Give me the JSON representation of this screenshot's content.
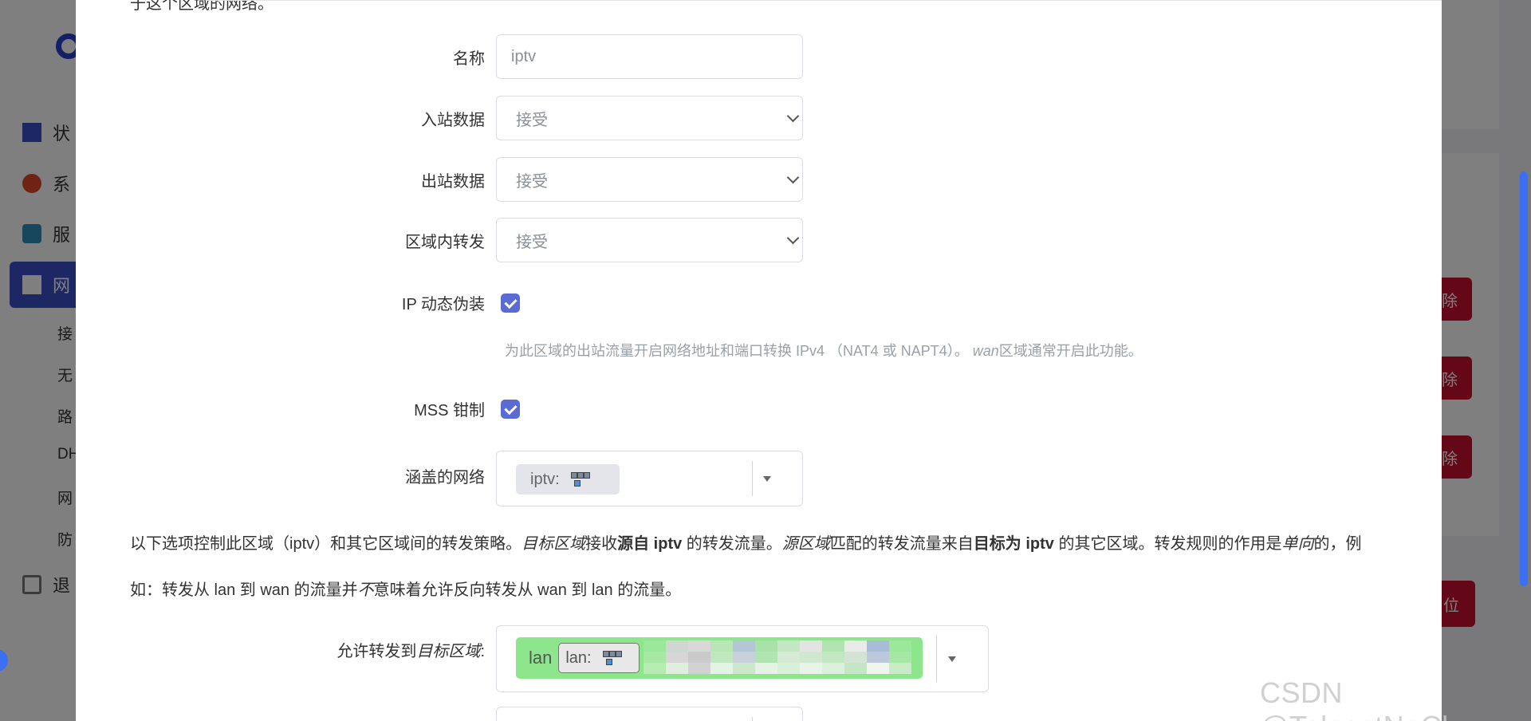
{
  "background": {
    "menu": [
      "状",
      "系",
      "服",
      "网",
      "退"
    ],
    "submenu": [
      "接",
      "无",
      "路",
      "DH",
      "网",
      "防"
    ],
    "buttons": [
      "除",
      "除",
      "除",
      "位"
    ]
  },
  "modal": {
    "top_text": "于这个区域的网络。",
    "fields": {
      "name_label": "名称",
      "name_value": "iptv",
      "input_label": "入站数据",
      "input_value": "接受",
      "output_label": "出站数据",
      "output_value": "接受",
      "forward_label": "区域内转发",
      "forward_value": "接受",
      "masq_label": "IP 动态伪装",
      "masq_hint_pre": "为此区域的出站流量开启网络地址和端口转换 IPv4 （NAT4 或 NAPT4）。",
      "masq_hint_em": "wan",
      "masq_hint_post": "区域通常开启此功能。",
      "mss_label": "MSS 钳制",
      "covered_label": "涵盖的网络",
      "covered_tag": "iptv:"
    },
    "paragraph": {
      "p1": "以下选项控制此区域（iptv）和其它区域间的转发策略。",
      "p2": "目标区域",
      "p3": "接收",
      "p4": "源自 iptv",
      "p5": " 的转发流量。",
      "p6": "源区域",
      "p7": "匹配的转发流量来自",
      "p8": "目标为 iptv",
      "p9": " 的其它区域。转发规则的作用是",
      "p10": "单向",
      "p11": "的，例",
      "line2a": "如：转发从 lan 到 wan 的流量并",
      "line2b": "不",
      "line2c": "意味着允许反向转发从 wan 到 lan 的流量。"
    },
    "allow_forward": {
      "label_pre": "允许转发到",
      "label_em": "目标区域",
      "label_post": ":",
      "zone_name": "lan",
      "zone_tag": "lan:"
    }
  },
  "watermark": "CSDN @TeleostNaCl",
  "colors": {
    "accent": "#5b6bd6",
    "zone_green": "#8ee68c",
    "danger": "#c8102e"
  }
}
